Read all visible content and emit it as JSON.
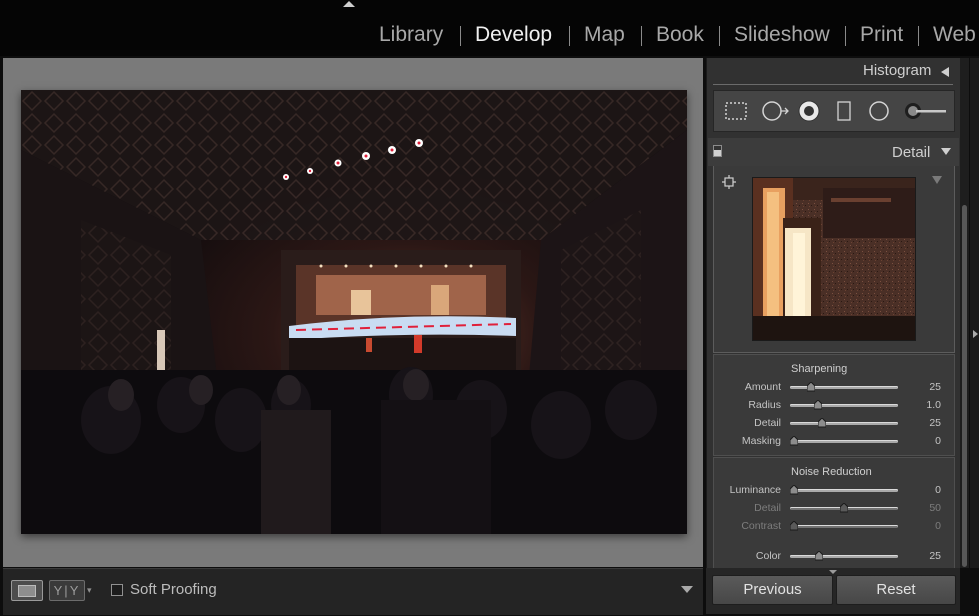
{
  "modules": {
    "items": [
      {
        "label": "Library"
      },
      {
        "label": "Develop"
      },
      {
        "label": "Map"
      },
      {
        "label": "Book"
      },
      {
        "label": "Slideshow"
      },
      {
        "label": "Print"
      },
      {
        "label": "Web"
      }
    ],
    "active": "Develop"
  },
  "right_panel": {
    "histogram_label": "Histogram",
    "tool_icons": [
      "crop-overlay-icon",
      "spot-removal-icon",
      "red-eye-icon",
      "graduated-filter-icon",
      "radial-filter-icon",
      "adjustment-brush-icon"
    ],
    "detail_label": "Detail",
    "sharpening": {
      "title": "Sharpening",
      "sliders": [
        {
          "label": "Amount",
          "value": "25",
          "fraction": 0.17,
          "dim": false
        },
        {
          "label": "Radius",
          "value": "1.0",
          "fraction": 0.24,
          "dim": false
        },
        {
          "label": "Detail",
          "value": "25",
          "fraction": 0.28,
          "dim": false
        },
        {
          "label": "Masking",
          "value": "0",
          "fraction": 0.0,
          "dim": false
        }
      ]
    },
    "noise_reduction": {
      "title": "Noise Reduction",
      "sliders": [
        {
          "label": "Luminance",
          "value": "0",
          "fraction": 0.0,
          "dim": false
        },
        {
          "label": "Detail",
          "value": "50",
          "fraction": 0.5,
          "dim": true
        },
        {
          "label": "Contrast",
          "value": "0",
          "fraction": 0.0,
          "dim": true
        },
        {
          "label": "Color",
          "value": "25",
          "fraction": 0.25,
          "dim": false
        }
      ]
    },
    "buttons": {
      "previous": "Previous",
      "reset": "Reset"
    }
  },
  "toolbar": {
    "yy_label": "Y|Y",
    "soft_proofing_label": "Soft Proofing",
    "soft_proofing_checked": false
  },
  "colors": {
    "accent_highlight_clip": "#d8e8ff",
    "shadow_clip": "#e0203a"
  }
}
